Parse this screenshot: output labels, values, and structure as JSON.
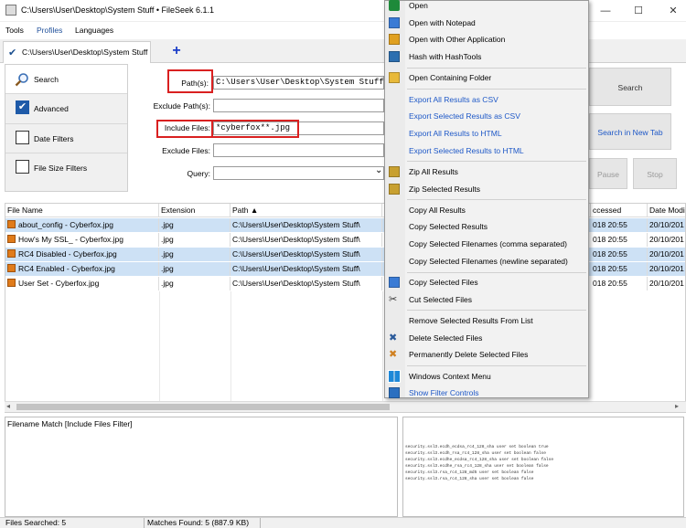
{
  "window": {
    "title": "C:\\Users\\User\\Desktop\\System Stuff • FileSeek 6.1.1",
    "minimize": "—",
    "maximize": "☐",
    "close": "✕"
  },
  "menu": [
    "Tools",
    "Profiles",
    "Languages"
  ],
  "tab": {
    "label": "C:\\Users\\User\\Desktop\\System Stuff",
    "add": "+"
  },
  "side": {
    "search": "Search",
    "advanced": "Advanced",
    "date_filters": "Date Filters",
    "size_filters": "File Size Filters",
    "checkmark": "✔"
  },
  "form": {
    "paths_label": "Path(s):",
    "paths_value": "C:\\Users\\User\\Desktop\\System Stuff",
    "exclude_paths_label": "Exclude Path(s):",
    "include_files_label": "Include Files:",
    "include_files_value": "*cyberfox**.jpg",
    "exclude_files_label": "Exclude Files:",
    "query_label": "Query:",
    "dropdown": "⌄"
  },
  "buttons": {
    "search": "Search",
    "search_new_tab": "Search in New Tab",
    "pause": "Pause",
    "stop": "Stop"
  },
  "grid": {
    "columns": [
      "File Name",
      "Extension",
      "Path ▲",
      "",
      "ccessed",
      "Date Modi"
    ],
    "rows": [
      {
        "name": "about_config - Cyberfox.jpg",
        "ext": ".jpg",
        "path": "C:\\Users\\User\\Desktop\\System Stuff\\",
        "accessed": "018 20:55",
        "modified": "20/10/201",
        "highlight": true
      },
      {
        "name": "How's My SSL_ - Cyberfox.jpg",
        "ext": ".jpg",
        "path": "C:\\Users\\User\\Desktop\\System Stuff\\",
        "accessed": "018 20:55",
        "modified": "20/10/201",
        "highlight": false
      },
      {
        "name": "RC4 Disabled - Cyberfox.jpg",
        "ext": ".jpg",
        "path": "C:\\Users\\User\\Desktop\\System Stuff\\",
        "accessed": "018 20:55",
        "modified": "20/10/201",
        "highlight": true
      },
      {
        "name": "RC4 Enabled - Cyberfox.jpg",
        "ext": ".jpg",
        "path": "C:\\Users\\User\\Desktop\\System Stuff\\",
        "accessed": "018 20:55",
        "modified": "20/10/201",
        "highlight": true
      },
      {
        "name": "User Set - Cyberfox.jpg",
        "ext": ".jpg",
        "path": "C:\\Users\\User\\Desktop\\System Stuff\\",
        "accessed": "018 20:55",
        "modified": "20/10/201",
        "highlight": false
      }
    ]
  },
  "detail": {
    "match_text": "Filename Match [Include Files Filter]"
  },
  "preview": {
    "lines": [
      "security.ssl3.ecdh_ecdsa_rc4_128_sha          user set      boolean     true",
      "security.ssl3.ecdh_rsa_rc4_128_sha            user set      boolean     false",
      "security.ssl3.ecdhe_ecdsa_rc4_128_sha         user set      boolean     false",
      "security.ssl3.ecdhe_rsa_rc4_128_sha           user set      boolean     false",
      "security.ssl3.rsa_rc4_128_md5                 user set      boolean     false",
      "security.ssl3.rsa_rc4_128_sha                 user set      boolean     false"
    ]
  },
  "status": {
    "files_searched": "Files Searched: 5",
    "matches_found": "Matches Found: 5 (887.9 KB)"
  },
  "context_menu": {
    "items": [
      {
        "label": "Open",
        "icon": "open-icon",
        "color": "#1e8a3a",
        "blue": false
      },
      {
        "label": "Open with Notepad",
        "icon": "notepad-icon",
        "color": "#3a7bd5",
        "blue": false
      },
      {
        "label": "Open with Other Application",
        "icon": "app-icon",
        "color": "#e0a020",
        "blue": false
      },
      {
        "label": "Hash with HashTools",
        "icon": "hash-icon",
        "color": "#2c6fb0",
        "blue": false
      },
      {
        "sep": true
      },
      {
        "label": "Open Containing Folder",
        "icon": "folder-icon",
        "color": "#e8b93a",
        "blue": false
      },
      {
        "sep": true
      },
      {
        "label": "Export All Results as CSV",
        "icon": "",
        "color": "",
        "blue": true
      },
      {
        "label": "Export Selected Results as CSV",
        "icon": "",
        "color": "",
        "blue": true
      },
      {
        "label": "Export All Results to HTML",
        "icon": "",
        "color": "",
        "blue": true
      },
      {
        "label": "Export Selected Results to HTML",
        "icon": "",
        "color": "",
        "blue": true
      },
      {
        "sep": true
      },
      {
        "label": "Zip All Results",
        "icon": "zip-icon",
        "color": "#c8a030",
        "blue": false
      },
      {
        "label": "Zip Selected Results",
        "icon": "zip-icon",
        "color": "#c8a030",
        "blue": false
      },
      {
        "sep": true
      },
      {
        "label": "Copy All Results",
        "icon": "",
        "color": "",
        "blue": false
      },
      {
        "label": "Copy Selected Results",
        "icon": "",
        "color": "",
        "blue": false
      },
      {
        "label": "Copy Selected Filenames (comma separated)",
        "icon": "",
        "color": "",
        "blue": false
      },
      {
        "label": "Copy Selected Filenames (newline separated)",
        "icon": "",
        "color": "",
        "blue": false
      },
      {
        "sep": true
      },
      {
        "label": "Copy Selected Files",
        "icon": "copy-icon",
        "color": "#3a7bd5",
        "blue": false
      },
      {
        "label": "Cut Selected Files",
        "icon": "scissors-icon",
        "color": "#333333",
        "blue": false
      },
      {
        "sep": true
      },
      {
        "label": "Remove Selected Results From List",
        "icon": "",
        "color": "",
        "blue": false
      },
      {
        "label": "Delete Selected Files",
        "icon": "delete-icon",
        "color": "#2a5a9a",
        "blue": false
      },
      {
        "label": "Permanently Delete Selected Files",
        "icon": "delete-icon",
        "color": "#d08020",
        "blue": false
      },
      {
        "sep": true
      },
      {
        "label": "Windows Context Menu",
        "icon": "windows-icon",
        "color": "#1e88d8",
        "blue": false
      },
      {
        "label": "Show Filter Controls",
        "icon": "filter-icon",
        "color": "#2a6fc0",
        "blue": true
      }
    ]
  },
  "colors": {
    "accent": "#1e5aa8",
    "highlight_row": "#cde1f5",
    "callout": "#d92020",
    "link_blue": "#1e58c7"
  }
}
